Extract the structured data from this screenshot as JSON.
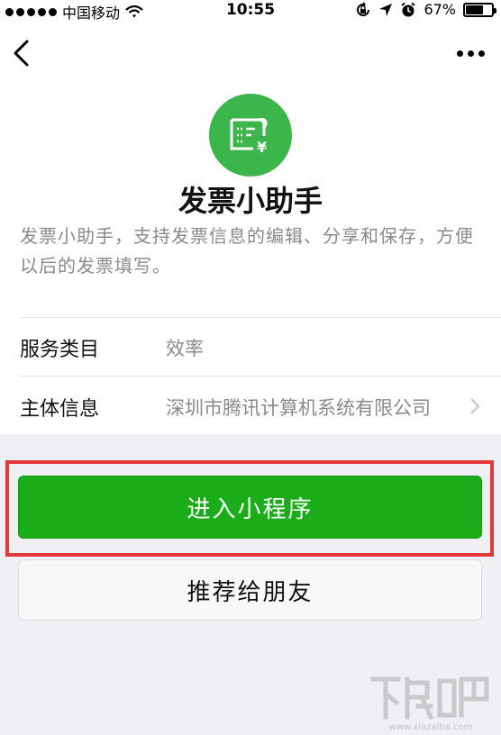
{
  "status_bar": {
    "carrier": "中国移动",
    "time": "10:55",
    "battery_percent": "67%",
    "battery_level": 0.67,
    "icons": [
      "signal-dots-icon",
      "wifi-icon",
      "orientation-lock-icon",
      "location-icon",
      "alarm-icon",
      "battery-icon"
    ]
  },
  "nav": {
    "back_icon": "chevron-left-icon",
    "more_icon": "more-dots-icon"
  },
  "app": {
    "logo_icon": "invoice-icon",
    "logo_color": "#3cb64a",
    "name": "发票小助手",
    "description": "发票小助手，支持发票信息的编辑、分享和保存，方便以后的发票填写。"
  },
  "info_rows": [
    {
      "label": "服务类目",
      "value": "效率"
    },
    {
      "label": "主体信息",
      "value": "深圳市腾讯计算机系统有限公司",
      "chevron": "chevron-right-icon"
    }
  ],
  "actions": {
    "enter_label": "进入小程序",
    "share_label": "推荐给朋友",
    "enter_color": "#1aad19",
    "highlight_color": "#e3393a"
  },
  "watermark": {
    "brand_logo": "xiazaiba-logo",
    "url_text": "www.xiazaiba.com"
  }
}
